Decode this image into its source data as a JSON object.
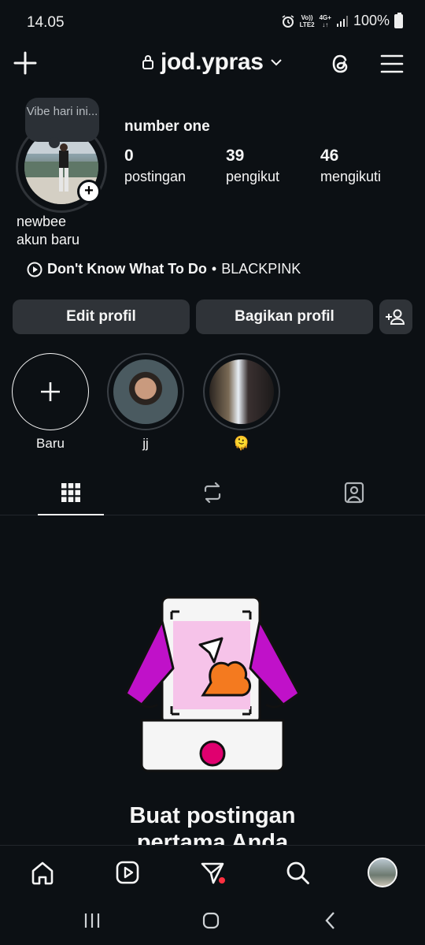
{
  "status_bar": {
    "time": "14.05",
    "network_top": "Vo))",
    "network_bottom": "LTE2",
    "data_top": "4G+",
    "data_bottom": "↓↑",
    "battery": "100%"
  },
  "header": {
    "username": "jod.ypras",
    "icons": [
      "plus-icon",
      "lock-icon",
      "chevron-down-icon",
      "threads-icon",
      "menu-icon"
    ]
  },
  "profile": {
    "note": "Vibe hari ini...",
    "display_name": "number one",
    "stats": [
      {
        "value": "0",
        "label": "postingan"
      },
      {
        "value": "39",
        "label": "pengikut"
      },
      {
        "value": "46",
        "label": "mengikuti"
      }
    ],
    "bio_line1": "newbee",
    "bio_line2": "akun baru",
    "music": {
      "song": "Don't Know What To Do",
      "separator": "•",
      "artist": "BLACKPINK"
    }
  },
  "buttons": {
    "edit": "Edit profil",
    "share": "Bagikan profil"
  },
  "highlights": [
    {
      "label": "Baru"
    },
    {
      "label": "jj"
    },
    {
      "label": "🫠"
    }
  ],
  "tabs": [
    "grid-icon",
    "reels-repost-icon",
    "tagged-icon"
  ],
  "empty_state": {
    "title_line1": "Buat postingan",
    "title_line2": "pertama Anda"
  },
  "bottom_nav": [
    "home-icon",
    "reels-icon",
    "send-icon",
    "search-icon",
    "profile-avatar"
  ],
  "colors": {
    "background": "#0c1014",
    "button": "#2f3338",
    "accent_magenta": "#c011c9",
    "accent_orange": "#f47a1f",
    "accent_red": "#ff3040"
  }
}
